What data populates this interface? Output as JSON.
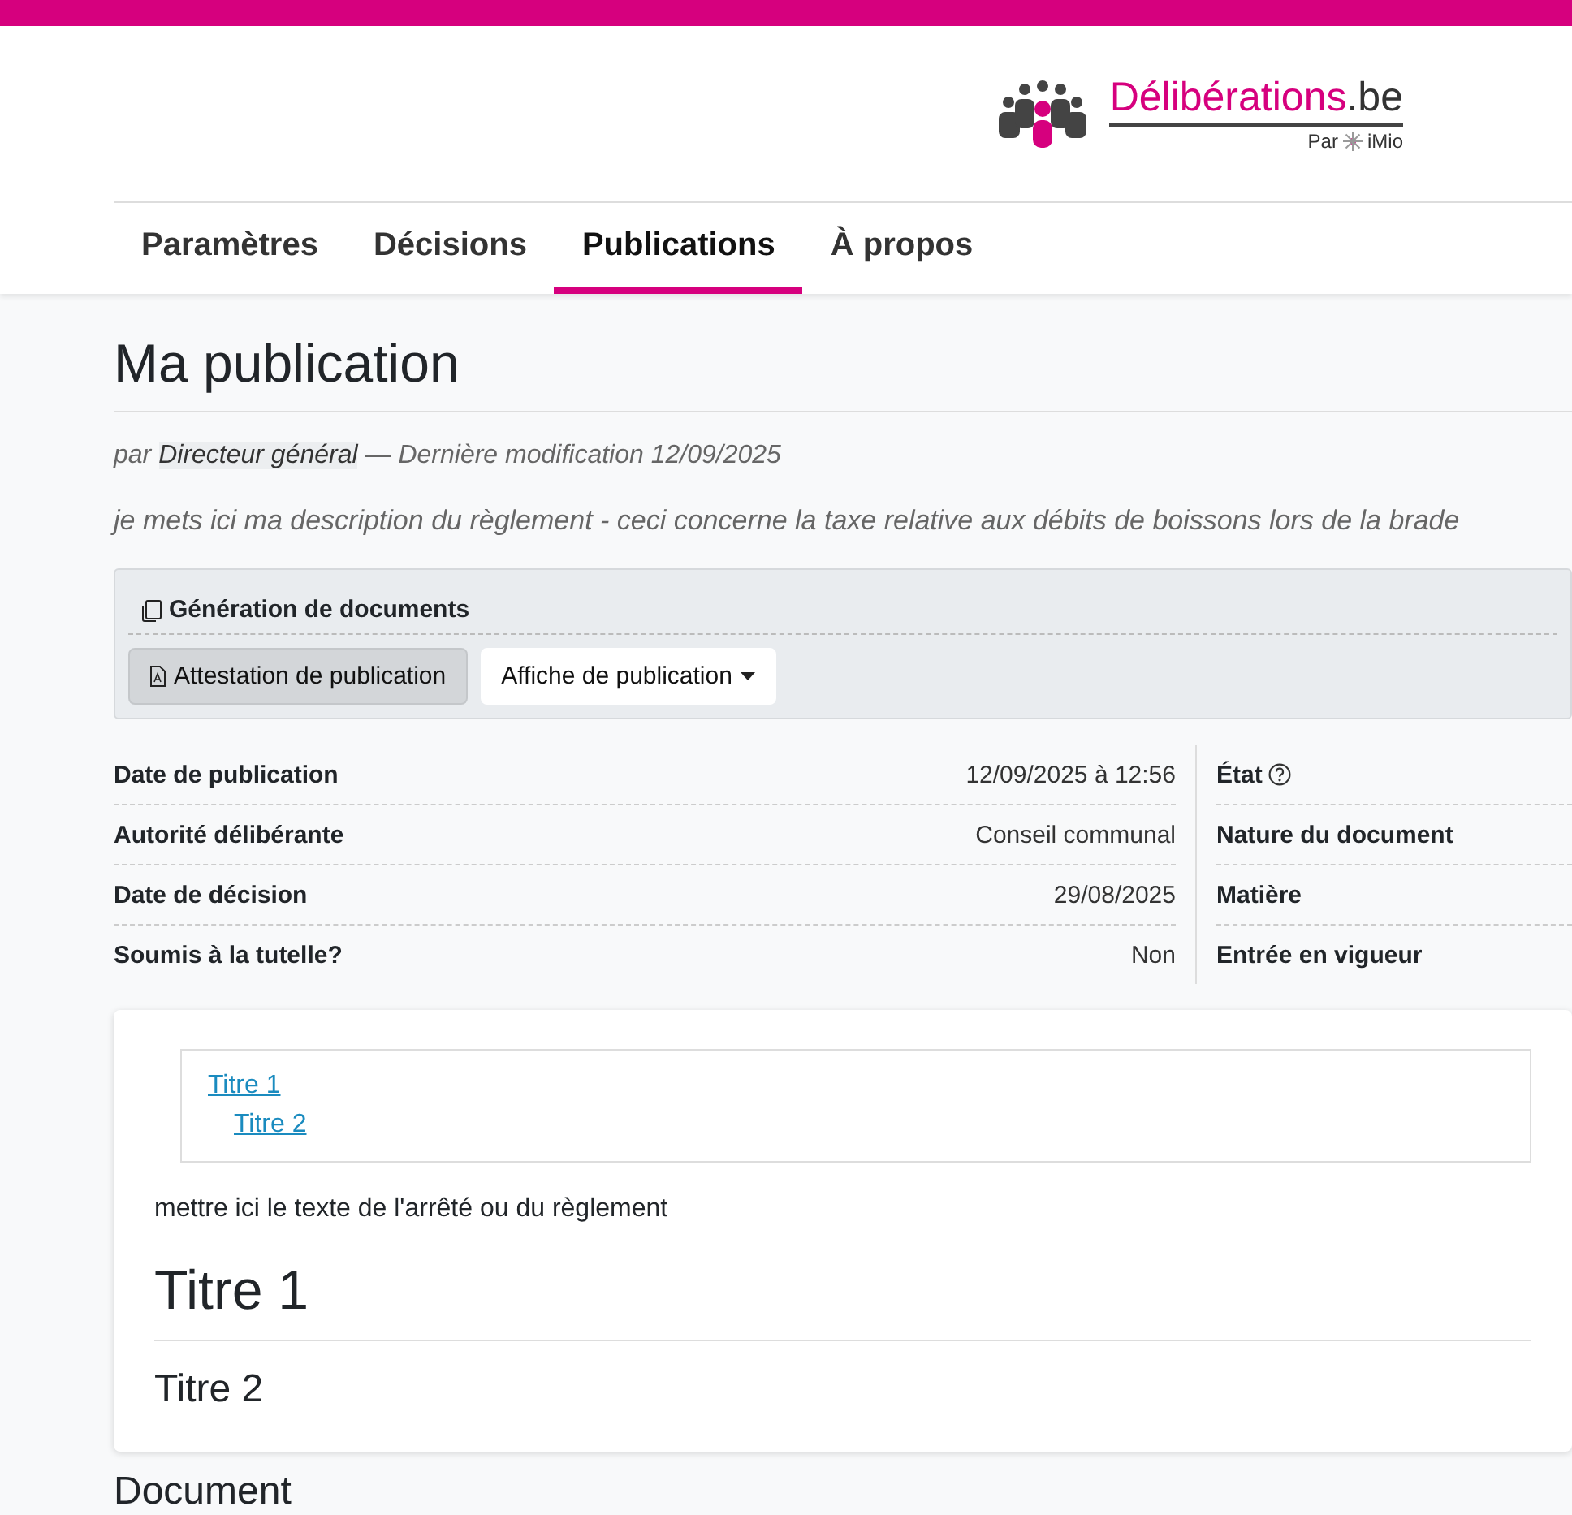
{
  "logo": {
    "name": "Délibérations",
    "suffix": ".be",
    "by": "Par",
    "org": "iMio"
  },
  "nav": [
    {
      "label": "Paramètres",
      "selected": false
    },
    {
      "label": "Décisions",
      "selected": false
    },
    {
      "label": "Publications",
      "selected": true
    },
    {
      "label": "À propos",
      "selected": false
    }
  ],
  "title": "Ma publication",
  "byline": {
    "prefix": "par",
    "author": "Directeur général",
    "modified": "— Dernière modification 12/09/2025"
  },
  "description": "je mets ici ma description du règlement - ceci concerne la taxe relative aux débits de boissons lors de la brade",
  "doc_generation": {
    "title": "Génération de documents",
    "buttons": [
      {
        "label": "Attestation de publication",
        "kind": "pdf"
      },
      {
        "label": "Affiche de publication",
        "kind": "dropdown"
      }
    ]
  },
  "details_left": [
    {
      "label": "Date de publication",
      "value": "12/09/2025 à 12:56"
    },
    {
      "label": "Autorité délibérante",
      "value": "Conseil communal"
    },
    {
      "label": "Date de décision",
      "value": "29/08/2025"
    },
    {
      "label": "Soumis à la tutelle?",
      "value": "Non"
    }
  ],
  "details_right": [
    {
      "label": "État",
      "help": true
    },
    {
      "label": "Nature du document",
      "help": false
    },
    {
      "label": "Matière",
      "help": false
    },
    {
      "label": "Entrée en vigueur",
      "help": false
    }
  ],
  "toc": [
    {
      "label": "Titre 1",
      "children": [
        {
          "label": "Titre 2"
        }
      ]
    }
  ],
  "body": {
    "text": "mettre ici le texte de l'arrêté ou du règlement",
    "heading1": "Titre 1",
    "heading2": "Titre 2"
  },
  "next_section": "Document"
}
